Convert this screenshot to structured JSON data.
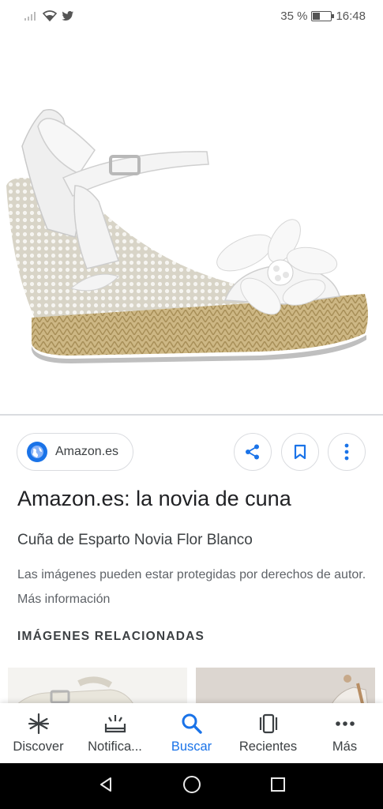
{
  "status_bar": {
    "battery_text": "35 %",
    "battery_level": 0.35,
    "time": "16:48",
    "icons": [
      "signal-icon",
      "wifi-icon",
      "twitter-icon",
      "battery-icon"
    ]
  },
  "image": {
    "description_icon": "wedge-sandal-image"
  },
  "source": {
    "label": "Amazon.es",
    "icon": "globe-icon"
  },
  "actions": {
    "share_icon": "share-icon",
    "save_icon": "bookmark-icon",
    "more_icon": "more-vert-icon"
  },
  "result": {
    "title": "Amazon.es: la novia de cuna",
    "subtitle": "Cuña de Esparto Novia Flor Blanco",
    "notice": "Las imágenes pueden estar protegidas por derechos de autor. Más información"
  },
  "related": {
    "heading": "IMÁGENES RELACIONADAS"
  },
  "bottom_nav": {
    "items": [
      {
        "label": "Discover",
        "icon": "asterisk-icon",
        "active": false
      },
      {
        "label": "Notifica...",
        "icon": "notifications-icon",
        "active": false
      },
      {
        "label": "Buscar",
        "icon": "search-icon",
        "active": true
      },
      {
        "label": "Recientes",
        "icon": "recents-icon",
        "active": false
      },
      {
        "label": "Más",
        "icon": "more-horiz-icon",
        "active": false
      }
    ]
  },
  "colors": {
    "accent": "#1a73e8",
    "text": "#202124",
    "muted": "#5f6368",
    "border": "#dadce0"
  }
}
